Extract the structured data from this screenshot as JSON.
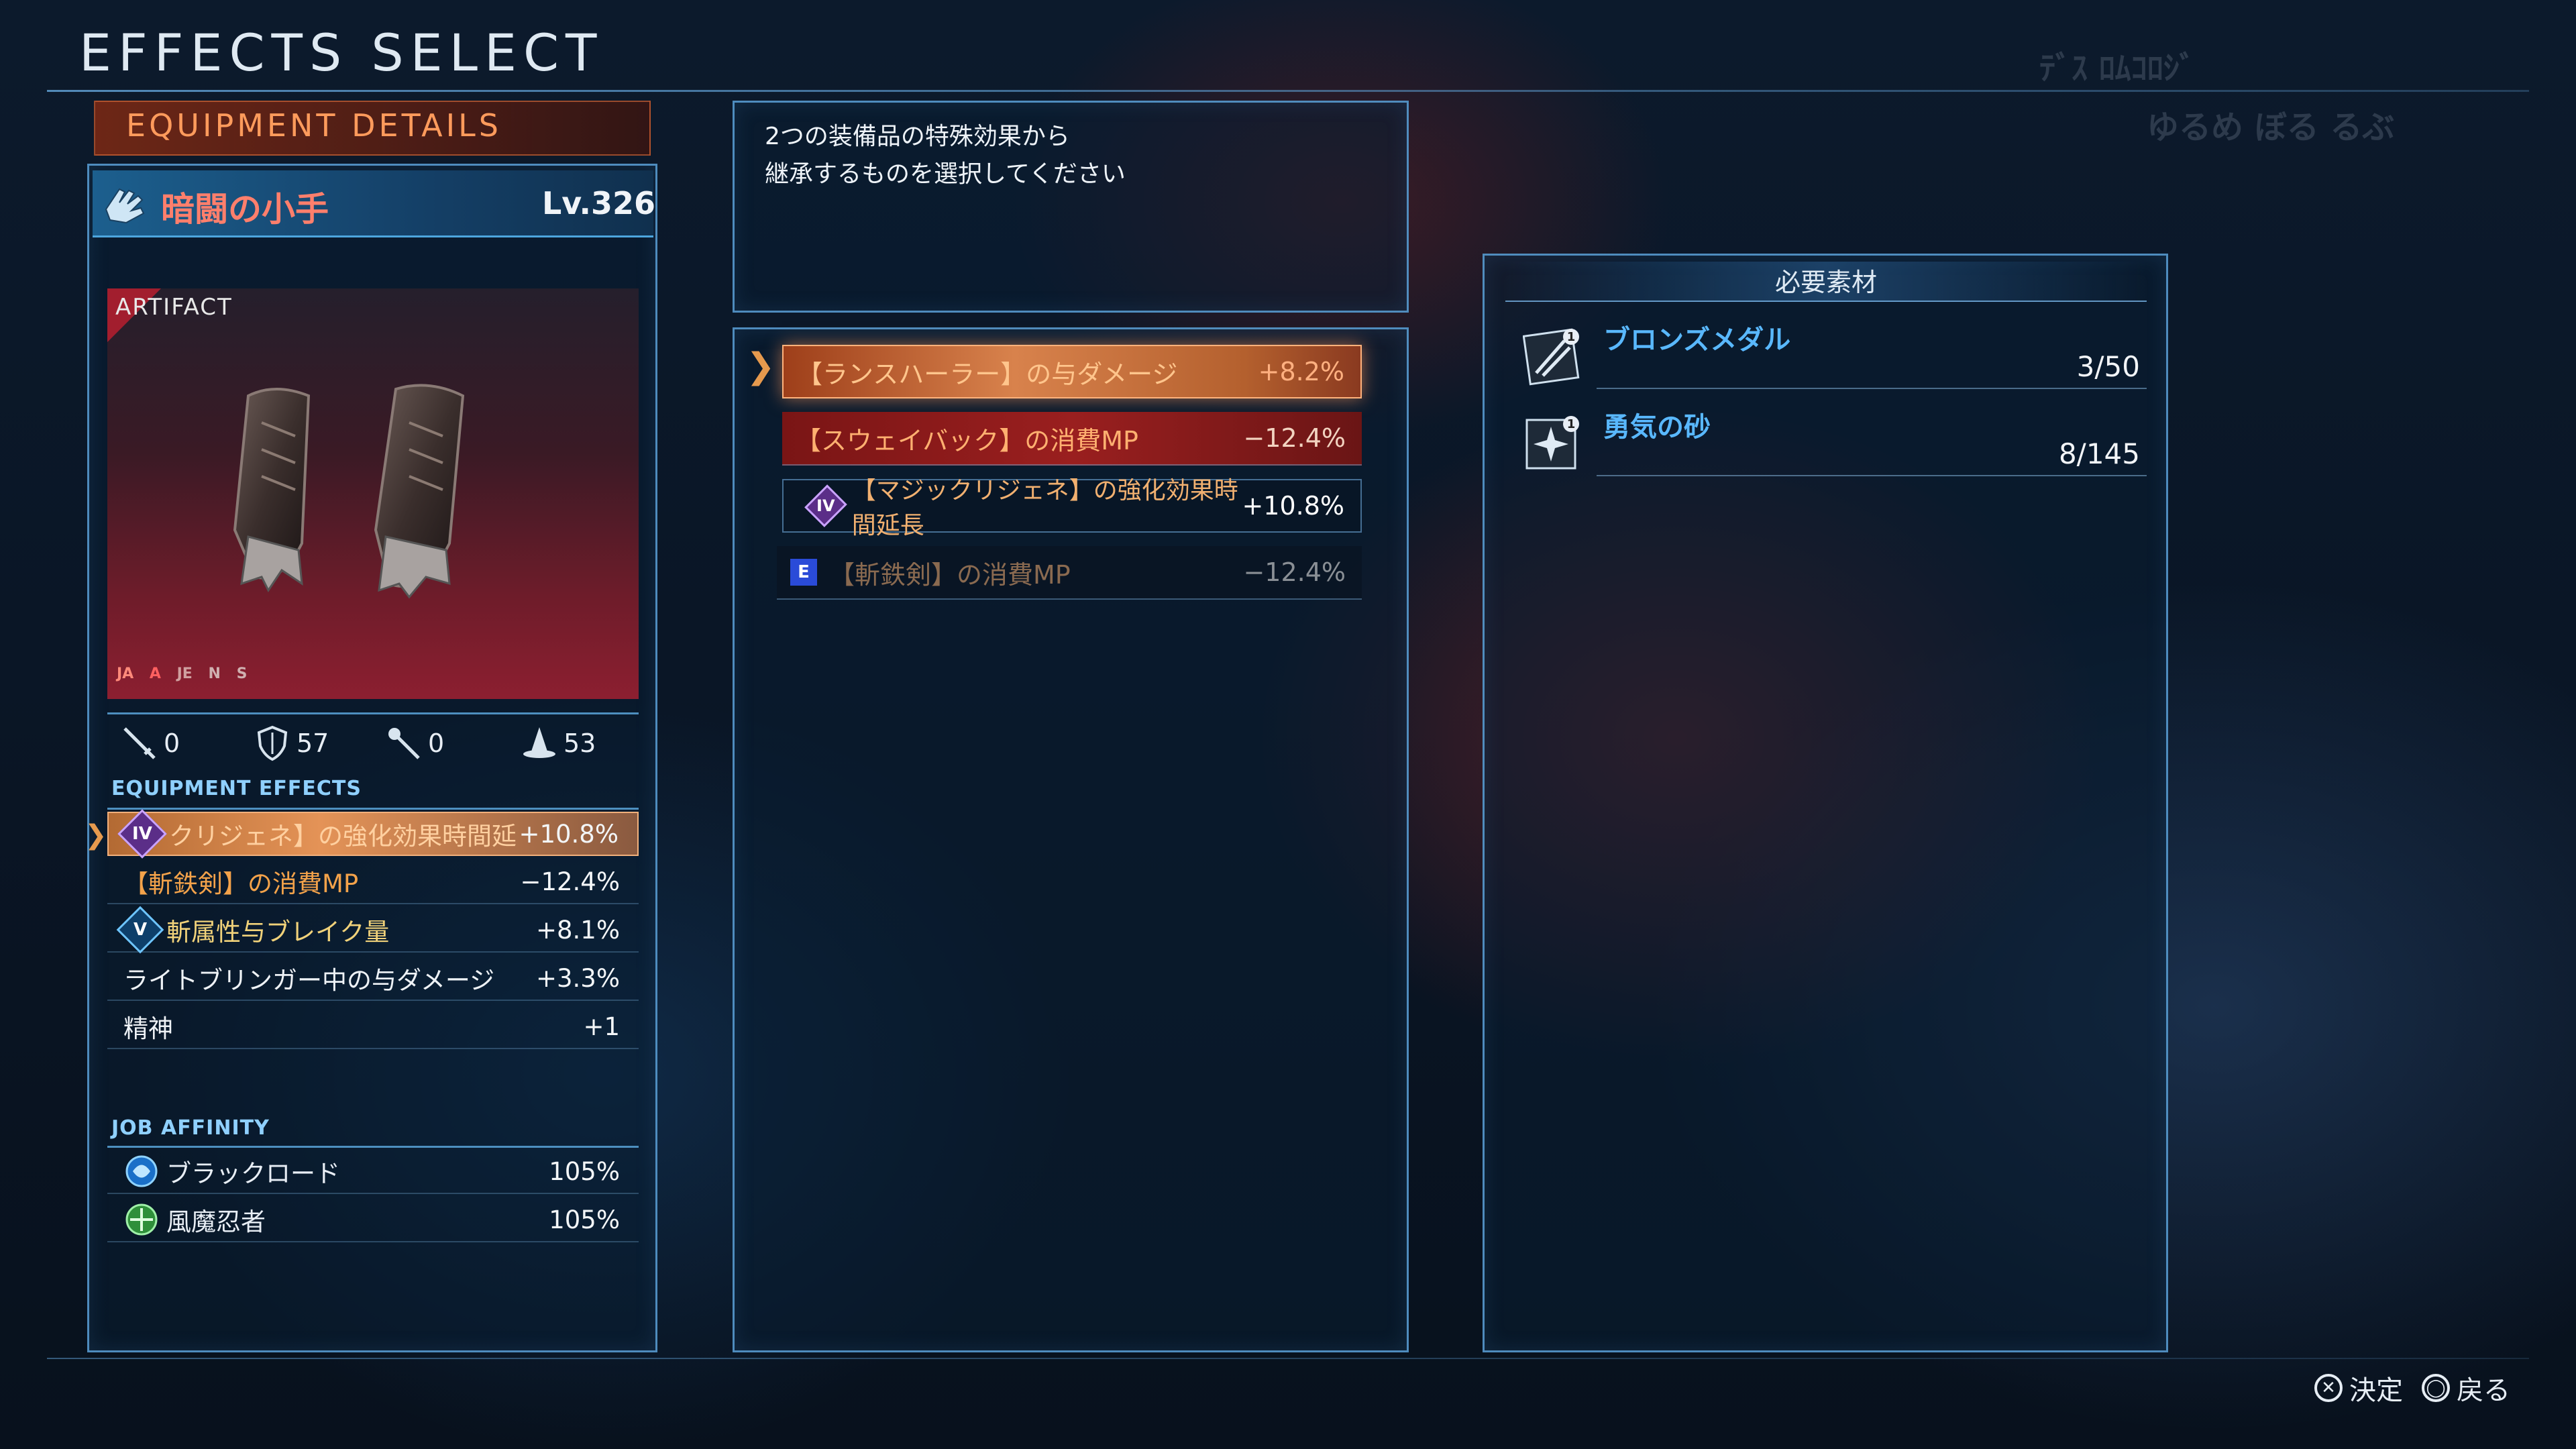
{
  "header": {
    "title": "EFFECTS SELECT",
    "blurred_top_1": "ﾃﾞｽ ﾛﾑｺﾛｼﾞ",
    "blurred_top_2": "ゆるめ ぼる るぶ"
  },
  "equipment_details": {
    "header_label": "EQUIPMENT DETAILS",
    "item_name": "暗闘の小手",
    "item_level": "Lv.326",
    "item_icon": "gauntlet-icon",
    "rarity_label": "ARTIFACT",
    "job_tags": [
      "JA",
      "A",
      "JE",
      "N",
      "S"
    ],
    "stats": [
      {
        "icon": "sword-icon",
        "value": "0"
      },
      {
        "icon": "shield-icon",
        "value": "57"
      },
      {
        "icon": "wand-icon",
        "value": "0"
      },
      {
        "icon": "hat-icon",
        "value": "53"
      }
    ],
    "effects_label": "EQUIPMENT EFFECTS",
    "effects": [
      {
        "badge": "IV",
        "label": "クリジェネ】の強化効果時間延",
        "value": "+10.8%"
      },
      {
        "badge": "",
        "label": "【斬鉄剣】の消費MP",
        "value": "−12.4%"
      },
      {
        "badge": "V",
        "label": "斬属性与ブレイク量",
        "value": "+8.1%"
      },
      {
        "badge": "",
        "label": "ライトブリンガー中の与ダメージ",
        "value": "+3.3%"
      },
      {
        "badge": "",
        "label": "精神",
        "value": "+1"
      }
    ],
    "job_affinity_label": "JOB AFFINITY",
    "job_affinity": [
      {
        "icon": "black-lord-icon",
        "label": "ブラックロード",
        "value": "105%"
      },
      {
        "icon": "ninja-icon",
        "label": "風魔忍者",
        "value": "105%"
      }
    ]
  },
  "selection": {
    "description_line1": "2つの装備品の特殊効果から",
    "description_line2": "継承するものを選択してください",
    "options": [
      {
        "label": "【ランスハーラー】の与ダメージ",
        "value": "+8.2%"
      },
      {
        "label": "【スウェイバック】の消費MP",
        "value": "−12.4%"
      },
      {
        "label": "【マジックリジェネ】の強化効果時間延長",
        "value": "+10.8%",
        "badge": "IV"
      },
      {
        "label": "【斬鉄剣】の消費MP",
        "value": "−12.4%",
        "badge": "E"
      }
    ]
  },
  "materials": {
    "header": "必要素材",
    "items": [
      {
        "icon": "bronze-medal-icon",
        "name": "ブロンズメダル",
        "count": "3/50"
      },
      {
        "icon": "sand-icon",
        "name": "勇気の砂",
        "count": "8/145"
      }
    ]
  },
  "footer": {
    "confirm_button": "✕",
    "confirm_label": "決定",
    "back_button": "◯",
    "back_label": "戻る"
  },
  "colors": {
    "accent_blue": "#4da6de",
    "accent_orange": "#ff9b5c",
    "selected_orange": "#c46a2f",
    "red_item": "#ff7f6c"
  }
}
